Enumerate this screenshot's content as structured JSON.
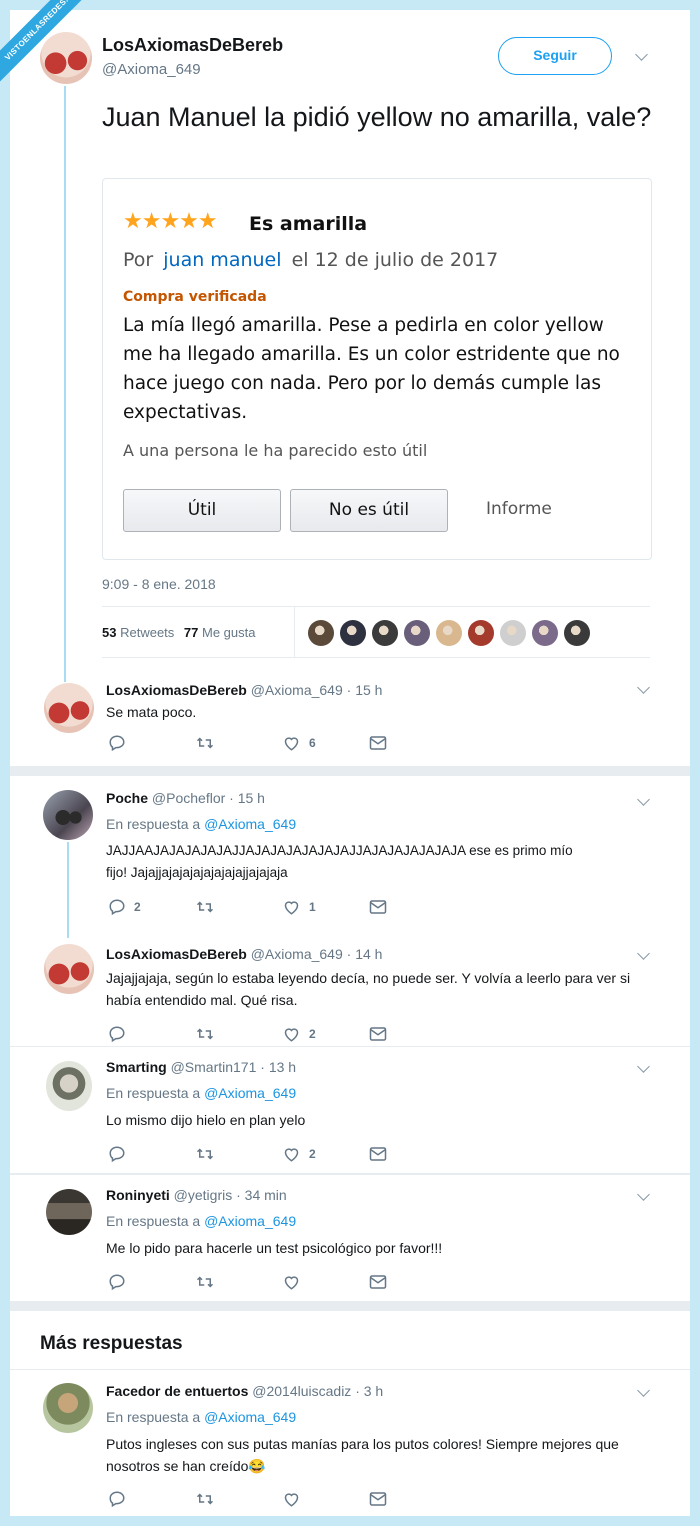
{
  "watermark": "VISTOENLASREDES.com",
  "colors": {
    "accent": "#1da1f2",
    "link": "#1b95e0",
    "background": "#e6ecf0",
    "frame": "#c7e9f5",
    "amazon_orange": "#c45500",
    "star": "#ffa41c"
  },
  "main_tweet": {
    "name": "LosAxiomasDeBereb",
    "handle": "@Axioma_649",
    "follow_label": "Seguir",
    "text": "Juan Manuel la pidió yellow no amarilla, vale?",
    "timestamp": "9:09 - 8 ene. 2018",
    "retweets_count": "53",
    "retweets_label": "Retweets",
    "likes_count": "77",
    "likes_label": "Me gusta",
    "liker_avatar_count": 9
  },
  "review": {
    "rating_stars": 5,
    "title": "Es amarilla",
    "by_prefix": "Por",
    "author": "juan manuel",
    "date": "el 12 de julio de 2017",
    "verified": "Compra verificada",
    "body": "La mía llegó amarilla. Pese a pedirla en color yellow me ha llegado amarilla. Es un color estridente que no hace juego con nada. Pero por lo demás cumple las expectativas.",
    "helpful_text": "A una persona le ha parecido esto útil",
    "btn_useful": "Útil",
    "btn_not_useful": "No es útil",
    "btn_report": "Informe"
  },
  "replies": [
    {
      "name": "LosAxiomasDeBereb",
      "handle": "@Axioma_649",
      "time": "· 15 h",
      "reply_to": "",
      "text": "Se mata poco.",
      "replies": "",
      "likes": "6"
    },
    {
      "name": "Poche",
      "handle": "@Pocheflor",
      "time": "· 15 h",
      "reply_prefix": "En respuesta a",
      "reply_to": "@Axioma_649",
      "text": "JAJJAAJAJAJAJAJAJJAJAJAJAJAJAJAJJAJAJAJAJAJAJA ese es primo mío fijo! Jajajjajajajajajajajajjajajaja",
      "replies": "2",
      "likes": "1"
    },
    {
      "name": "LosAxiomasDeBereb",
      "handle": "@Axioma_649",
      "time": "· 14 h",
      "reply_to": "",
      "text": "Jajajjajaja, según lo estaba leyendo decía, no puede ser. Y volvía a leerlo para ver si había entendido mal. Qué risa.",
      "replies": "",
      "likes": "2"
    },
    {
      "name": "Smarting",
      "handle": "@Smartin171",
      "time": "· 13 h",
      "reply_prefix": "En respuesta a",
      "reply_to": "@Axioma_649",
      "text": "Lo mismo dijo hielo en plan yelo",
      "replies": "",
      "likes": "2"
    },
    {
      "name": "Roninyeti",
      "handle": "@yetigris",
      "time": "· 34 min",
      "reply_prefix": "En respuesta a",
      "reply_to": "@Axioma_649",
      "text": "Me lo pido para hacerle un test psicológico por favor!!!",
      "replies": "",
      "likes": ""
    }
  ],
  "more_replies_heading": "Más respuestas",
  "more_reply": {
    "name": "Facedor de entuertos",
    "handle": "@2014luiscadiz",
    "time": "· 3 h",
    "reply_prefix": "En respuesta a",
    "reply_to": "@Axioma_649",
    "text": "Putos ingleses con sus putas manías para los putos colores! Siempre mejores que nosotros se han creído😂",
    "replies": "",
    "likes": ""
  }
}
